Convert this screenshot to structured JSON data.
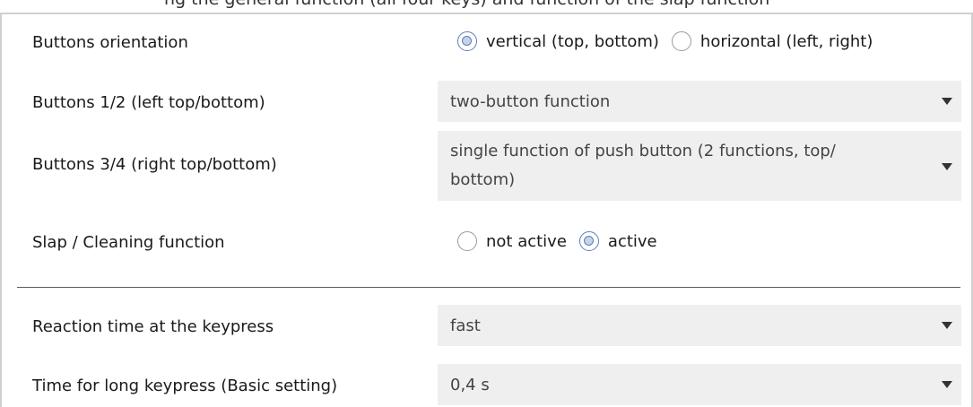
{
  "caption_fragment": "ng the general function (all four keys) and function of the slap function",
  "rows": {
    "orientation": {
      "label": "Buttons orientation",
      "options": [
        "vertical (top, bottom)",
        "horizontal (left, right)"
      ],
      "selected": "vertical (top, bottom)"
    },
    "buttons12": {
      "label": "Buttons 1/2 (left top/bottom)",
      "value": "two-button function"
    },
    "buttons34": {
      "label": "Buttons 3/4 (right top/bottom)",
      "value_line1": "single function of push button (2 functions, top/",
      "value_line2": "bottom)"
    },
    "slap": {
      "label": "Slap / Cleaning function",
      "options": [
        "not active",
        "active"
      ],
      "selected": "active"
    },
    "reaction": {
      "label": "Reaction time at the keypress",
      "value": "fast"
    },
    "longpress": {
      "label": "Time for long keypress (Basic setting)",
      "value": "0,4 s"
    }
  },
  "colors": {
    "radio_selected": "#5b7fb6",
    "dropdown_bg": "#efefef"
  },
  "icons": {
    "dropdown": "caret-down-icon",
    "radio": "radio-button-icon"
  }
}
